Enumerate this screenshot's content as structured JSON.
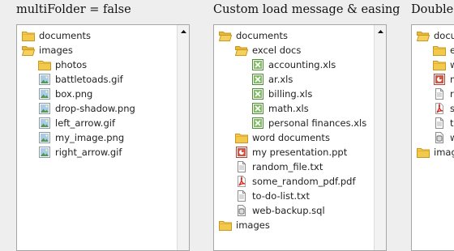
{
  "panels": [
    {
      "title": "multiFolder = false",
      "items": [
        {
          "name": "documents",
          "type": "folder",
          "depth": 0
        },
        {
          "name": "images",
          "type": "folder-open",
          "depth": 0
        },
        {
          "name": "photos",
          "type": "folder",
          "depth": 1
        },
        {
          "name": "battletoads.gif",
          "type": "image",
          "depth": 1
        },
        {
          "name": "box.png",
          "type": "image",
          "depth": 1
        },
        {
          "name": "drop-shadow.png",
          "type": "image",
          "depth": 1
        },
        {
          "name": "left_arrow.gif",
          "type": "image",
          "depth": 1
        },
        {
          "name": "my_image.png",
          "type": "image",
          "depth": 1
        },
        {
          "name": "right_arrow.gif",
          "type": "image",
          "depth": 1
        }
      ]
    },
    {
      "title": "Custom load message & easing",
      "items": [
        {
          "name": "documents",
          "type": "folder-open",
          "depth": 0
        },
        {
          "name": "excel docs",
          "type": "folder-open",
          "depth": 1
        },
        {
          "name": "accounting.xls",
          "type": "excel",
          "depth": 2
        },
        {
          "name": "ar.xls",
          "type": "excel",
          "depth": 2
        },
        {
          "name": "billing.xls",
          "type": "excel",
          "depth": 2
        },
        {
          "name": "math.xls",
          "type": "excel",
          "depth": 2
        },
        {
          "name": "personal finances.xls",
          "type": "excel",
          "depth": 2
        },
        {
          "name": "word documents",
          "type": "folder",
          "depth": 1
        },
        {
          "name": "my presentation.ppt",
          "type": "ppt",
          "depth": 1
        },
        {
          "name": "random_file.txt",
          "type": "text",
          "depth": 1
        },
        {
          "name": "some_random_pdf.pdf",
          "type": "pdf",
          "depth": 1
        },
        {
          "name": "to-do-list.txt",
          "type": "text",
          "depth": 1
        },
        {
          "name": "web-backup.sql",
          "type": "sql",
          "depth": 1
        },
        {
          "name": "images",
          "type": "folder",
          "depth": 0
        }
      ]
    },
    {
      "title": "Double",
      "items": [
        {
          "name": "documents",
          "type": "folder-open",
          "depth": 0
        },
        {
          "name": "e",
          "type": "folder",
          "depth": 1
        },
        {
          "name": "w",
          "type": "folder",
          "depth": 1
        },
        {
          "name": "m",
          "type": "ppt",
          "depth": 1
        },
        {
          "name": "r",
          "type": "text",
          "depth": 1
        },
        {
          "name": "s",
          "type": "pdf",
          "depth": 1
        },
        {
          "name": "t",
          "type": "text",
          "depth": 1
        },
        {
          "name": "w",
          "type": "sql",
          "depth": 1
        },
        {
          "name": "images",
          "type": "folder",
          "depth": 0
        }
      ]
    }
  ],
  "colors": {
    "background": "#eeeeee",
    "folder": "#f3c94c",
    "panel_border": "#a6a6a6"
  }
}
